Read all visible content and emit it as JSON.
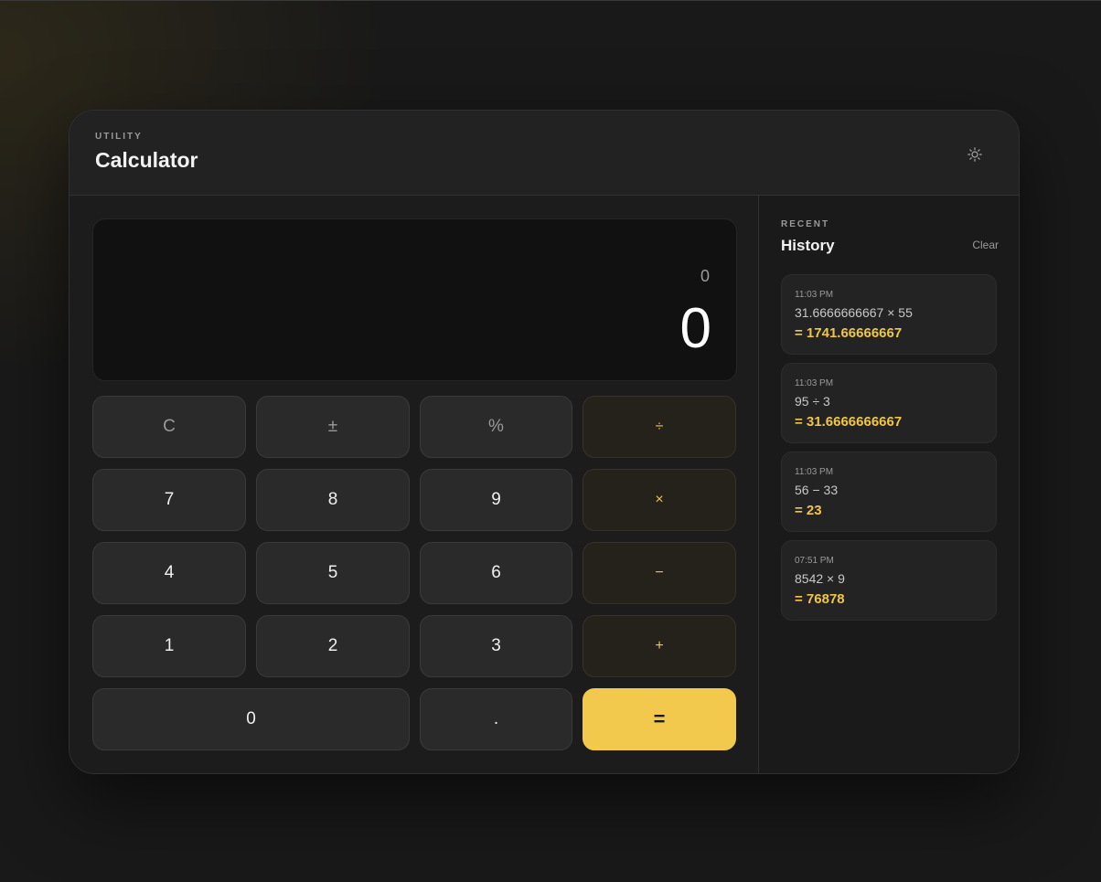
{
  "header": {
    "eyebrow": "UTILITY",
    "title": "Calculator",
    "theme_icon": "sun-icon"
  },
  "display": {
    "expression": "0",
    "result": "0"
  },
  "keypad": {
    "clear": "C",
    "sign": "±",
    "percent": "%",
    "divide": "÷",
    "seven": "7",
    "eight": "8",
    "nine": "9",
    "multiply": "×",
    "four": "4",
    "five": "5",
    "six": "6",
    "subtract": "−",
    "one": "1",
    "two": "2",
    "three": "3",
    "add": "+",
    "zero": "0",
    "decimal": ".",
    "equals": "="
  },
  "history": {
    "eyebrow": "RECENT",
    "title": "History",
    "clear_label": "Clear",
    "items": [
      {
        "time": "11:03 PM",
        "expression": "31.6666666667 × 55",
        "result": "= 1741.66666667"
      },
      {
        "time": "11:03 PM",
        "expression": "95 ÷ 3",
        "result": "= 31.6666666667"
      },
      {
        "time": "11:03 PM",
        "expression": "56 − 33",
        "result": "= 23"
      },
      {
        "time": "07:51 PM",
        "expression": "8542 × 9",
        "result": "= 76878"
      }
    ]
  },
  "colors": {
    "accent": "#f2c94c",
    "background": "#191919",
    "card": "#1c1c1c"
  }
}
